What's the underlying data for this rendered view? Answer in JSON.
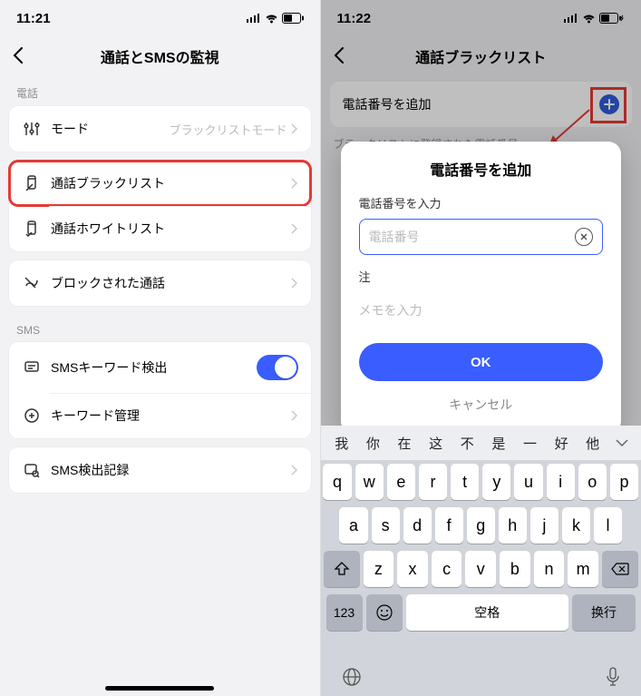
{
  "left": {
    "status": {
      "time": "11:21"
    },
    "title": "通話とSMSの監視",
    "sections": {
      "phone_label": "電話",
      "mode_label": "モード",
      "mode_value": "ブラックリストモード",
      "blacklist_label": "通話ブラックリスト",
      "whitelist_label": "通話ホワイトリスト",
      "blocked_label": "ブロックされた通話",
      "sms_label": "SMS",
      "kw_detect_label": "SMSキーワード検出",
      "kw_manage_label": "キーワード管理",
      "sms_log_label": "SMS検出記録"
    }
  },
  "right": {
    "status": {
      "time": "11:22"
    },
    "title": "通話ブラックリスト",
    "add_label": "電話番号を追加",
    "list_header": "ブラックリストに登録された電話番号",
    "modal": {
      "title": "電話番号を追加",
      "field1_label": "電話番号を入力",
      "field1_placeholder": "電話番号",
      "field2_label": "注",
      "field2_placeholder": "メモを入力",
      "ok": "OK",
      "cancel": "キャンセル"
    },
    "keyboard": {
      "suggestions": [
        "我",
        "你",
        "在",
        "这",
        "不",
        "是",
        "一",
        "好",
        "他"
      ],
      "row1": [
        "q",
        "w",
        "e",
        "r",
        "t",
        "y",
        "u",
        "i",
        "o",
        "p"
      ],
      "row2": [
        "a",
        "s",
        "d",
        "f",
        "g",
        "h",
        "j",
        "k",
        "l"
      ],
      "row3": [
        "z",
        "x",
        "c",
        "v",
        "b",
        "n",
        "m"
      ],
      "num": "123",
      "space": "空格",
      "ret": "换行"
    }
  }
}
